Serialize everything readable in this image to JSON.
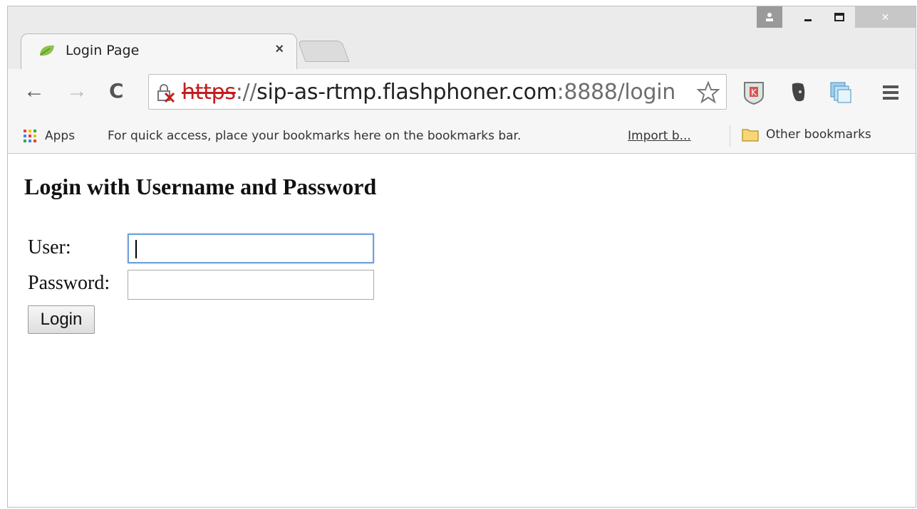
{
  "browser": {
    "tab": {
      "title": "Login Page",
      "close": "×"
    },
    "window_controls": {
      "minimize": "‒",
      "maximize": "□",
      "close": "×"
    },
    "nav": {
      "back": "←",
      "forward": "→",
      "reload": "C"
    },
    "url": {
      "scheme": "https",
      "separator": "://",
      "host": "sip-as-rtmp.flashphoner.com",
      "port_path": ":8888/login"
    },
    "bookmarks_bar": {
      "apps_label": "Apps",
      "hint": "For quick access, place your bookmarks here on the bookmarks bar.",
      "import_link": "Import b...",
      "other_bookmarks": "Other bookmarks"
    }
  },
  "page": {
    "heading": "Login with Username and Password",
    "user_label": "User:",
    "password_label": "Password:",
    "user_value": "",
    "password_value": "",
    "login_button": "Login"
  },
  "colors": {
    "insecure_scheme": "#c41c1c",
    "focus_ring": "#6fa1d9",
    "leaf_icon": "#8bc34a"
  }
}
